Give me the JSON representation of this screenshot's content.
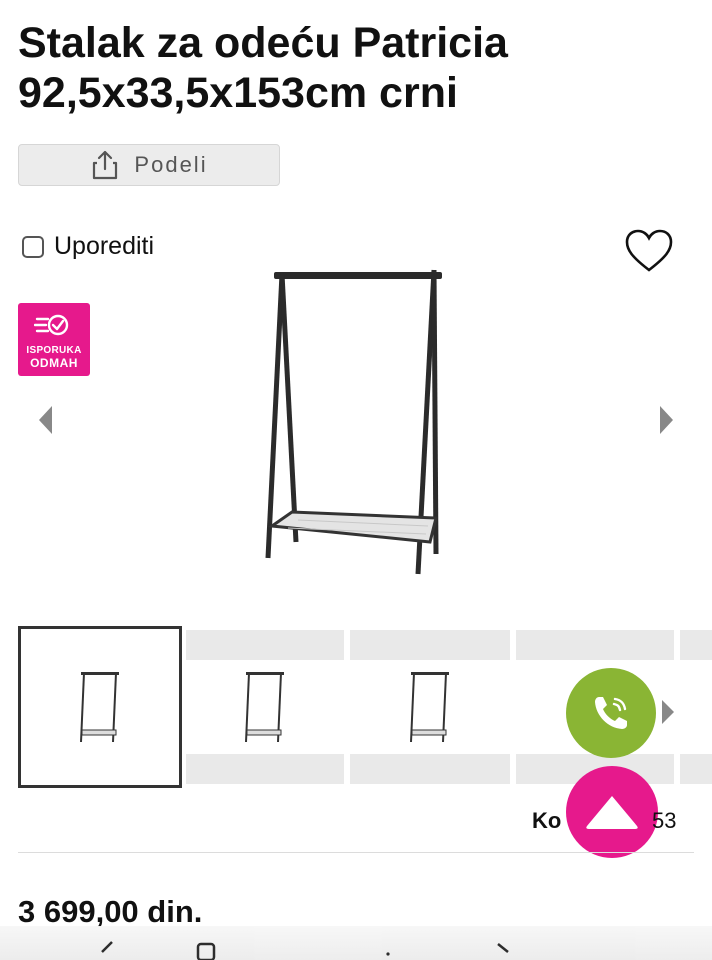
{
  "product": {
    "title": "Stalak za odeću Patricia 92,5x33,5x153cm crni",
    "share_label": "Podeli",
    "compare_label": "Uporediti",
    "badge": {
      "line1": "ISPORUKA",
      "line2": "ODMAH"
    },
    "code_label": "Ko",
    "code_value": "53",
    "price": "3 699,00 din."
  },
  "gallery": {
    "thumbnails": [
      {
        "selected": true
      },
      {
        "selected": false
      },
      {
        "selected": false
      },
      {
        "selected": false
      }
    ]
  },
  "colors": {
    "accent_pink": "#e6198c",
    "call_green": "#8ab534",
    "share_bg": "#ececec"
  },
  "icons": {
    "share": "share-icon",
    "heart": "heart-icon",
    "delivery": "fast-delivery-icon",
    "prev": "chevron-left-icon",
    "next": "chevron-right-icon",
    "call": "phone-icon",
    "top": "arrow-up-icon"
  }
}
